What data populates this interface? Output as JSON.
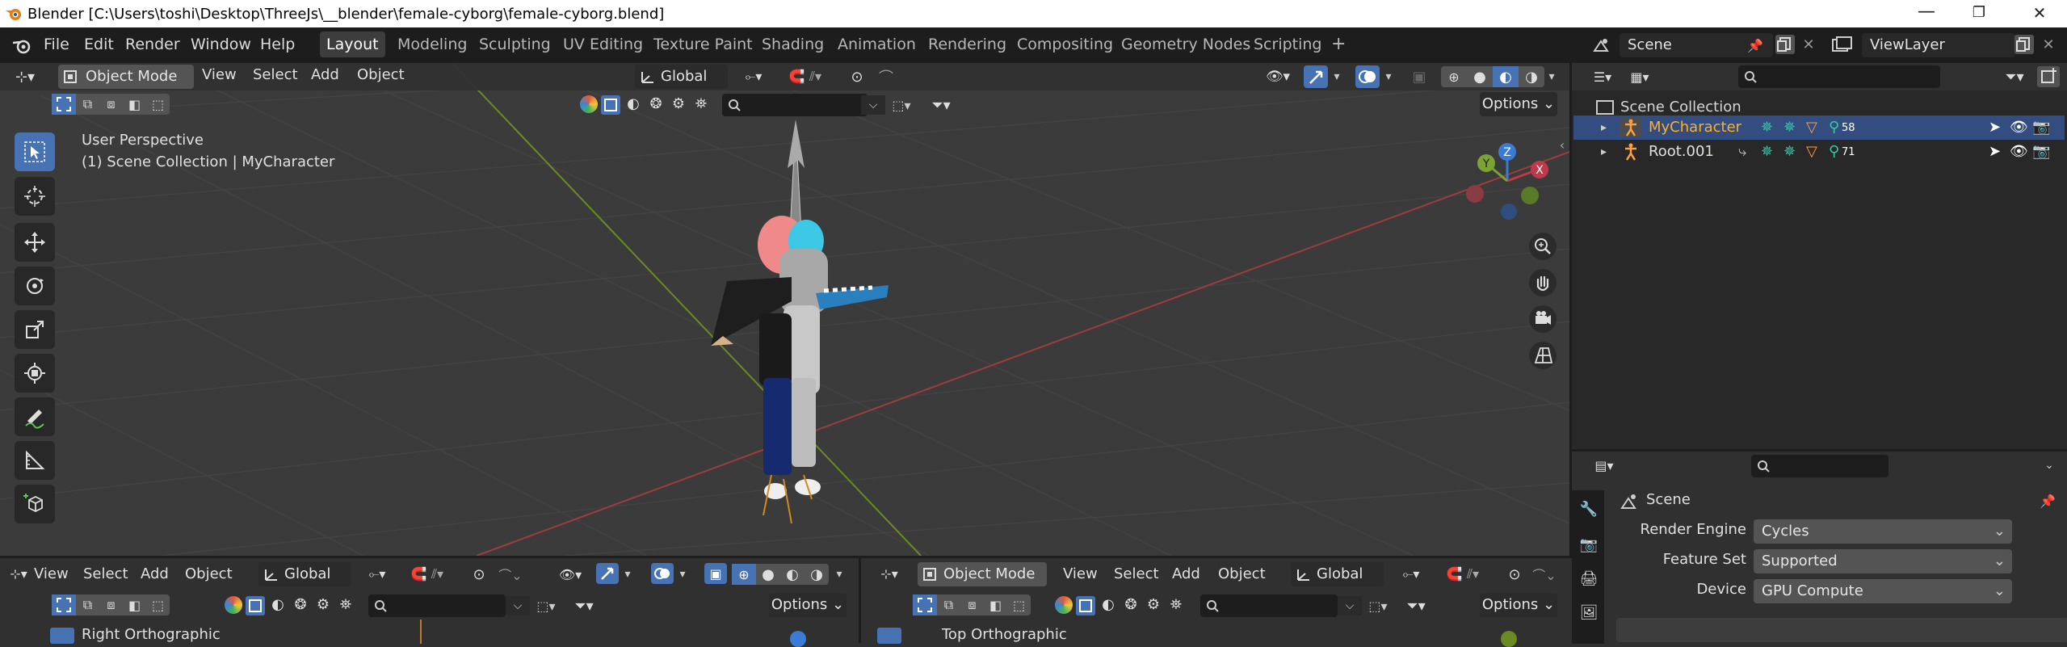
{
  "window": {
    "title": "Blender [C:\\Users\\toshi\\Desktop\\ThreeJs\\__blender\\female-cyborg\\female-cyborg.blend]",
    "minimize": "—",
    "maximize": "❐",
    "close": "✕"
  },
  "menu": {
    "items": [
      "File",
      "Edit",
      "Render",
      "Window",
      "Help"
    ],
    "workspaces": [
      "Layout",
      "Modeling",
      "Sculpting",
      "UV Editing",
      "Texture Paint",
      "Shading",
      "Animation",
      "Rendering",
      "Compositing",
      "Geometry Nodes",
      "Scripting"
    ],
    "active_workspace": "Layout",
    "add_workspace": "+",
    "scene": "Scene",
    "view_layer": "ViewLayer"
  },
  "viewport_header": {
    "mode": "Object Mode",
    "menus": [
      "View",
      "Select",
      "Add",
      "Object"
    ],
    "transform": "Global",
    "options": "Options"
  },
  "viewport": {
    "perspective": "User Perspective",
    "collection_info": "(1) Scene Collection | MyCharacter",
    "gizmo": {
      "x": "X",
      "y": "Y",
      "z": "Z"
    }
  },
  "outliner": {
    "root": "Scene Collection",
    "items": [
      {
        "name": "MyCharacter",
        "count": "58",
        "selected": true
      },
      {
        "name": "Root.001",
        "count": "71",
        "selected": false
      }
    ]
  },
  "properties": {
    "header": "Scene",
    "rows": [
      {
        "label": "Render Engine",
        "value": "Cycles"
      },
      {
        "label": "Feature Set",
        "value": "Supported"
      },
      {
        "label": "Device",
        "value": "GPU Compute"
      }
    ]
  },
  "bottom_left_view": {
    "menus": [
      "View",
      "Select",
      "Add",
      "Object"
    ],
    "transform": "Global",
    "options": "Options",
    "title": "Right Orthographic"
  },
  "bottom_right_view": {
    "mode": "Object Mode",
    "menus": [
      "View",
      "Select",
      "Add",
      "Object"
    ],
    "transform": "Global",
    "options": "Options",
    "title": "Top Orthographic"
  },
  "colors": {
    "selection_blue": "#4772b3",
    "selected_name": "#ffaf29",
    "axis_red": "#9c3d3d",
    "axis_green": "#6a8a22"
  }
}
